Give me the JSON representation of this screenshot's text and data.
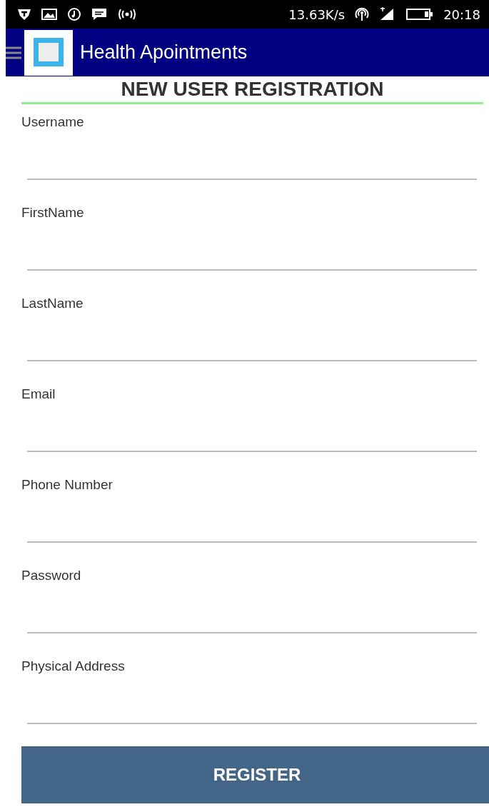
{
  "status_bar": {
    "speed": "13.63K/s",
    "time": "20:18"
  },
  "app_bar": {
    "title": "Health Apointments"
  },
  "heading": "NEW USER REGISTRATION",
  "fields": [
    {
      "label": "Username"
    },
    {
      "label": "FirstName"
    },
    {
      "label": "LastName"
    },
    {
      "label": "Email"
    },
    {
      "label": "Phone Number"
    },
    {
      "label": "Password"
    },
    {
      "label": "Physical Address"
    }
  ],
  "submit": {
    "label": "REGISTER"
  }
}
